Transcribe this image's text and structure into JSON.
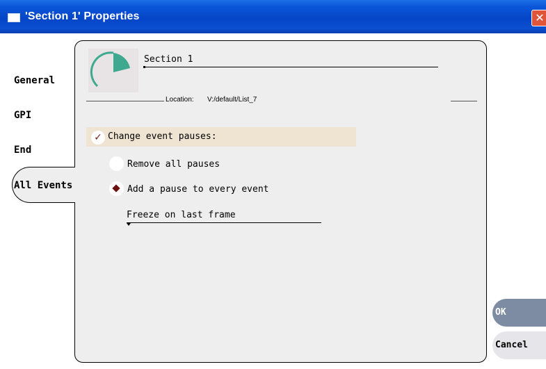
{
  "window": {
    "title": "'Section 1' Properties",
    "close_glyph": "✕"
  },
  "tabs": [
    {
      "label": "General",
      "active": false
    },
    {
      "label": "GPI",
      "active": false
    },
    {
      "label": "End",
      "active": false
    },
    {
      "label": "All Events",
      "active": true
    }
  ],
  "section": {
    "name": "Section 1",
    "location_label": "Location:",
    "location_value": "V:/default/List_7"
  },
  "change_pauses": {
    "checked": true,
    "check_glyph": "✓",
    "label": "Change event pauses:"
  },
  "pause_options": [
    {
      "label": "Remove all pauses",
      "selected": false
    },
    {
      "label": "Add a pause to every event",
      "selected": true
    }
  ],
  "pause_type": {
    "value": "Freeze on last frame"
  },
  "buttons": {
    "ok": "OK",
    "cancel": "Cancel"
  },
  "colors": {
    "titlebar": "#0a4fd0",
    "panel": "#eeeeee",
    "highlight_row": "#efe4d2",
    "accent_mark": "#6b0f0f",
    "ok_button": "#7d8ba3",
    "icon_teal": "#3fa98f"
  },
  "icons": {
    "window": "window-icon",
    "section": "clock-segment-icon",
    "check": "check-icon",
    "radio_selected": "diamond-icon",
    "dropdown": "dropdown-arrow-icon"
  }
}
